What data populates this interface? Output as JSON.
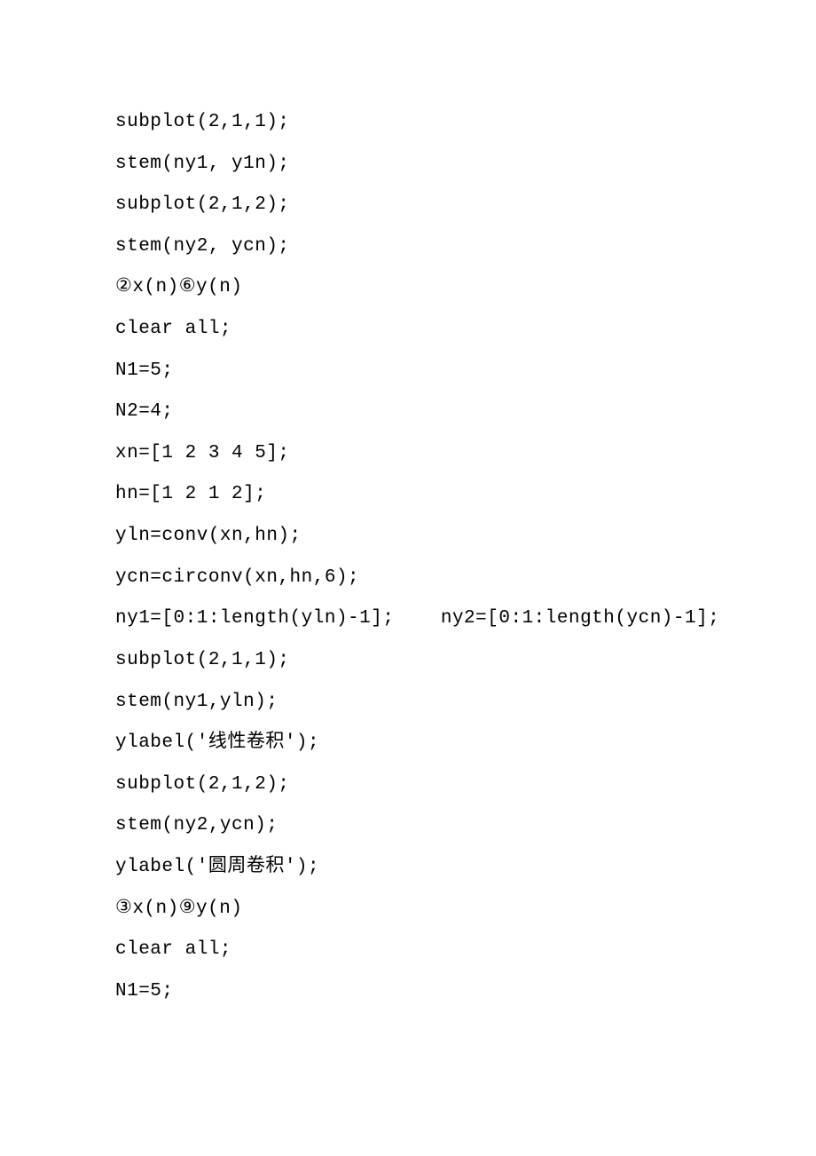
{
  "lines": [
    "subplot(2,1,1);",
    "stem(ny1, y1n);",
    "subplot(2,1,2);",
    "stem(ny2, ycn);",
    "②x(n)⑥y(n)",
    "clear all;",
    "N1=5;",
    "N2=4;",
    "xn=[1 2 3 4 5];",
    "hn=[1 2 1 2];",
    "yln=conv(xn,hn);",
    "ycn=circonv(xn,hn,6);",
    "ny1=[0:1:length(yln)-1];    ny2=[0:1:length(ycn)-1];",
    "subplot(2,1,1);",
    "stem(ny1,yln);",
    "ylabel('线性卷积');",
    "subplot(2,1,2);",
    "stem(ny2,ycn);",
    "ylabel('圆周卷积');",
    "③x(n)⑨y(n)",
    "clear all;",
    "N1=5;"
  ]
}
